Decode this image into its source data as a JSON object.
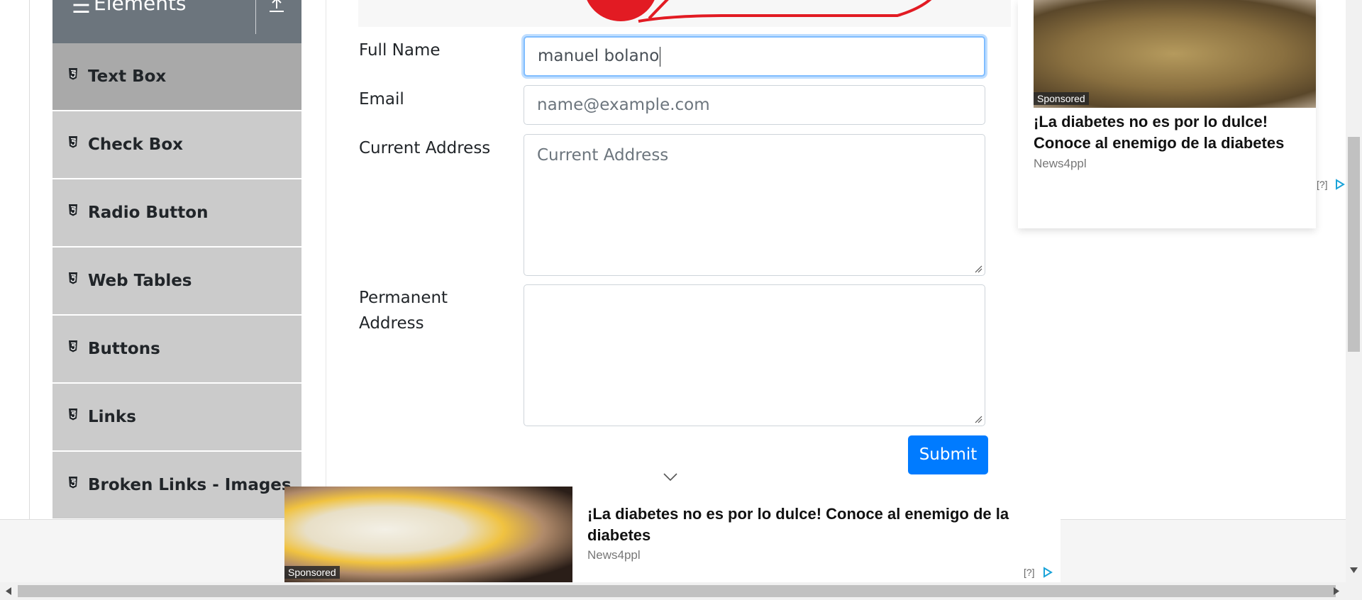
{
  "sidebar": {
    "group_title": "Elements",
    "items": [
      {
        "label": "Text Box",
        "active": true
      },
      {
        "label": "Check Box"
      },
      {
        "label": "Radio Button"
      },
      {
        "label": "Web Tables"
      },
      {
        "label": "Buttons"
      },
      {
        "label": "Links"
      },
      {
        "label": "Broken Links - Images"
      }
    ]
  },
  "form": {
    "full_name_label": "Full Name",
    "full_name_value": "manuel bolano",
    "email_label": "Email",
    "email_placeholder": "name@example.com",
    "current_address_label": "Current Address",
    "current_address_placeholder": "Current Address",
    "permanent_address_label_line1": "Permanent",
    "permanent_address_label_line2": "Address",
    "submit_label": "Submit"
  },
  "side_ad": {
    "sponsored": "Sponsored",
    "headline": "¡La diabetes no es por lo dulce! Conoce al enemigo de la diabetes",
    "source": "News4ppl",
    "info": "[?]"
  },
  "bottom_ad": {
    "sponsored": "Sponsored",
    "headline": "¡La diabetes no es por lo dulce! Conoce al enemigo de la diabetes",
    "source": "News4ppl",
    "info": "[?]"
  },
  "colors": {
    "sidebar_header": "#6c757d",
    "sidebar_item": "#cbcbcb",
    "sidebar_item_active": "#a9a9a9",
    "submit_button": "#007bff",
    "focus_ring": "#80bdff"
  }
}
